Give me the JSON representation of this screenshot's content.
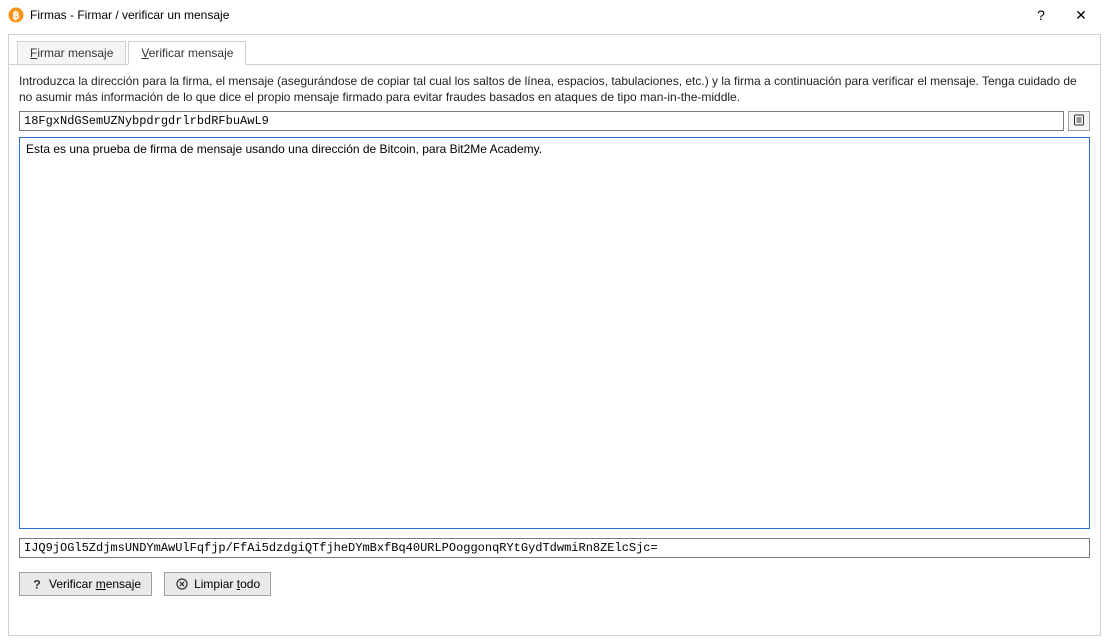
{
  "window": {
    "title": "Firmas - Firmar / verificar un mensaje",
    "help_glyph": "?",
    "close_glyph": "✕"
  },
  "tabs": {
    "sign": "Firmar mensaje",
    "verify": "Verificar mensaje"
  },
  "instructions": "Introduzca la dirección para la firma, el mensaje (asegurándose de copiar tal cual los saltos de línea, espacios, tabulaciones, etc.) y la firma a continuación para verificar el mensaje. Tenga cuidado de no asumir más información de lo que dice el propio mensaje firmado para evitar fraudes basados en ataques de tipo man-in-the-middle.",
  "fields": {
    "address": "18FgxNdGSemUZNybpdrgdrlrbdRFbuAwL9",
    "message": "Esta es una prueba de firma de mensaje usando una dirección de Bitcoin, para Bit2Me Academy.",
    "signature": "IJQ9jOGl5ZdjmsUNDYmAwUlFqfjp/FfAi5dzdgiQTfjheDYmBxfBq40URLPOoggonqRYtGydTdwmiRn8ZElcSjc="
  },
  "buttons": {
    "verify": "Verificar mensaje",
    "clear": "Limpiar todo"
  },
  "icons": {
    "address_book_tooltip": "Seleccionar dirección"
  }
}
